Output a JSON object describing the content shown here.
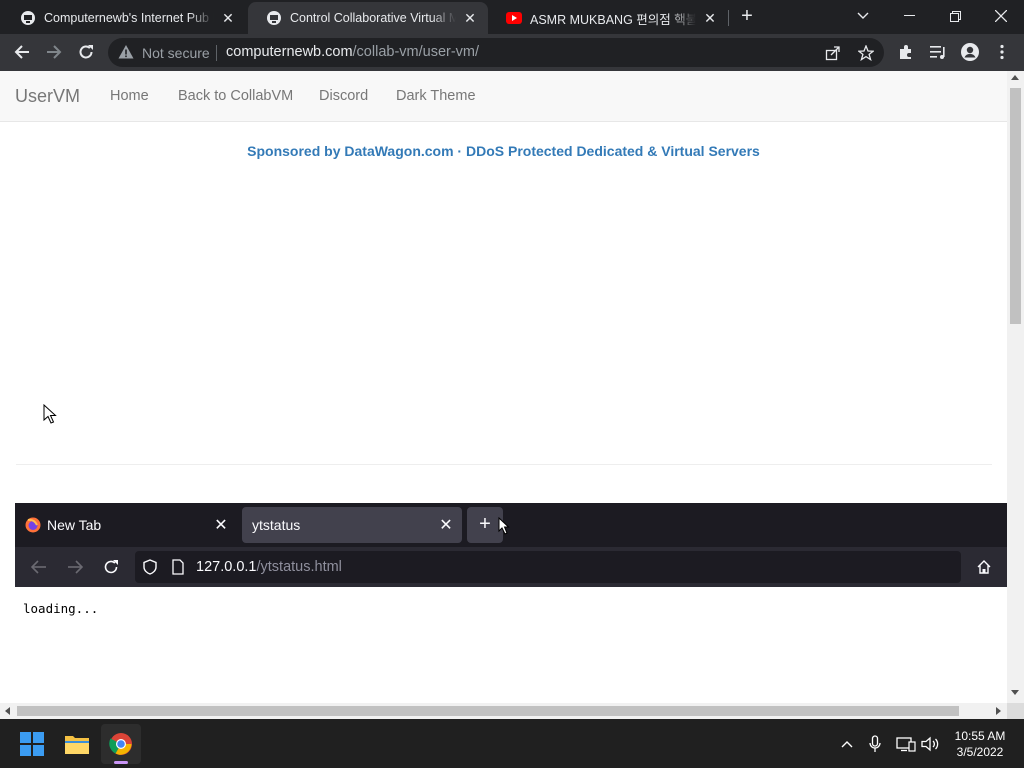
{
  "browser": {
    "tabs": [
      {
        "title": "Computernewb's Internet Pub Hub",
        "icon": "vm-logo-icon",
        "active": false
      },
      {
        "title": "Control Collaborative Virtual Machines",
        "icon": "vm-logo-icon",
        "active": true
      },
      {
        "title": "ASMR MUKBANG 편의점 핵불닭",
        "icon": "youtube-icon",
        "active": false
      }
    ],
    "new_tab_label": "+",
    "security_label": "Not secure",
    "url_host": "computernewb.com",
    "url_path": "/collab-vm/user-vm/"
  },
  "page": {
    "brand": "UserVM",
    "nav": [
      "Home",
      "Back to CollabVM",
      "Discord",
      "Dark Theme"
    ],
    "sponsor_text": "Sponsored by DataWagon.com · DDoS Protected Dedicated & Virtual Servers"
  },
  "vm": {
    "tabs": [
      {
        "title": "New Tab",
        "icon": "firefox-icon",
        "selected": false
      },
      {
        "title": "ytstatus",
        "icon": "",
        "selected": true
      }
    ],
    "new_tab_label": "+",
    "url_host": "127.0.0.1",
    "url_path": "/ytstatus.html",
    "content_text": "loading..."
  },
  "taskbar": {
    "time": "10:55 AM",
    "date": "3/5/2022"
  },
  "colors": {
    "chrome_dark": "#202124",
    "chrome_toolbar": "#35363a",
    "link_blue": "#337ab7",
    "firefox_dark": "#1c1b22"
  }
}
